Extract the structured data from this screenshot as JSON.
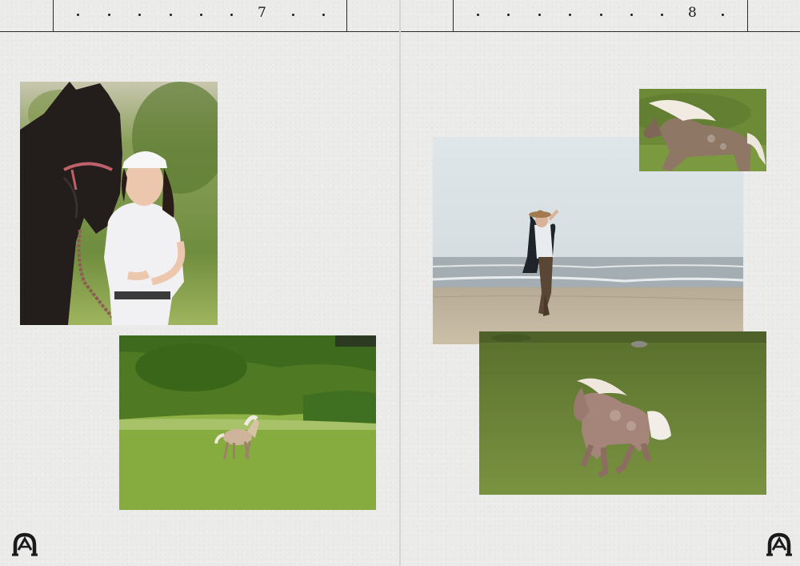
{
  "left_page": {
    "page_number": "7",
    "photos": [
      {
        "name": "woman-with-dark-horse-photo"
      },
      {
        "name": "pony-running-on-field-photo"
      }
    ],
    "logo": "horseshoe-a-logo"
  },
  "right_page": {
    "page_number": "8",
    "photos": [
      {
        "name": "pony-mane-closeup-photo"
      },
      {
        "name": "woman-on-beach-photo"
      },
      {
        "name": "pony-galloping-on-grass-photo"
      }
    ],
    "logo": "horseshoe-a-logo"
  },
  "colors": {
    "paper": "#ebebea",
    "ink": "#1a1a1a",
    "grass": "#6f8a3a",
    "sky": "#d9e2e5"
  }
}
